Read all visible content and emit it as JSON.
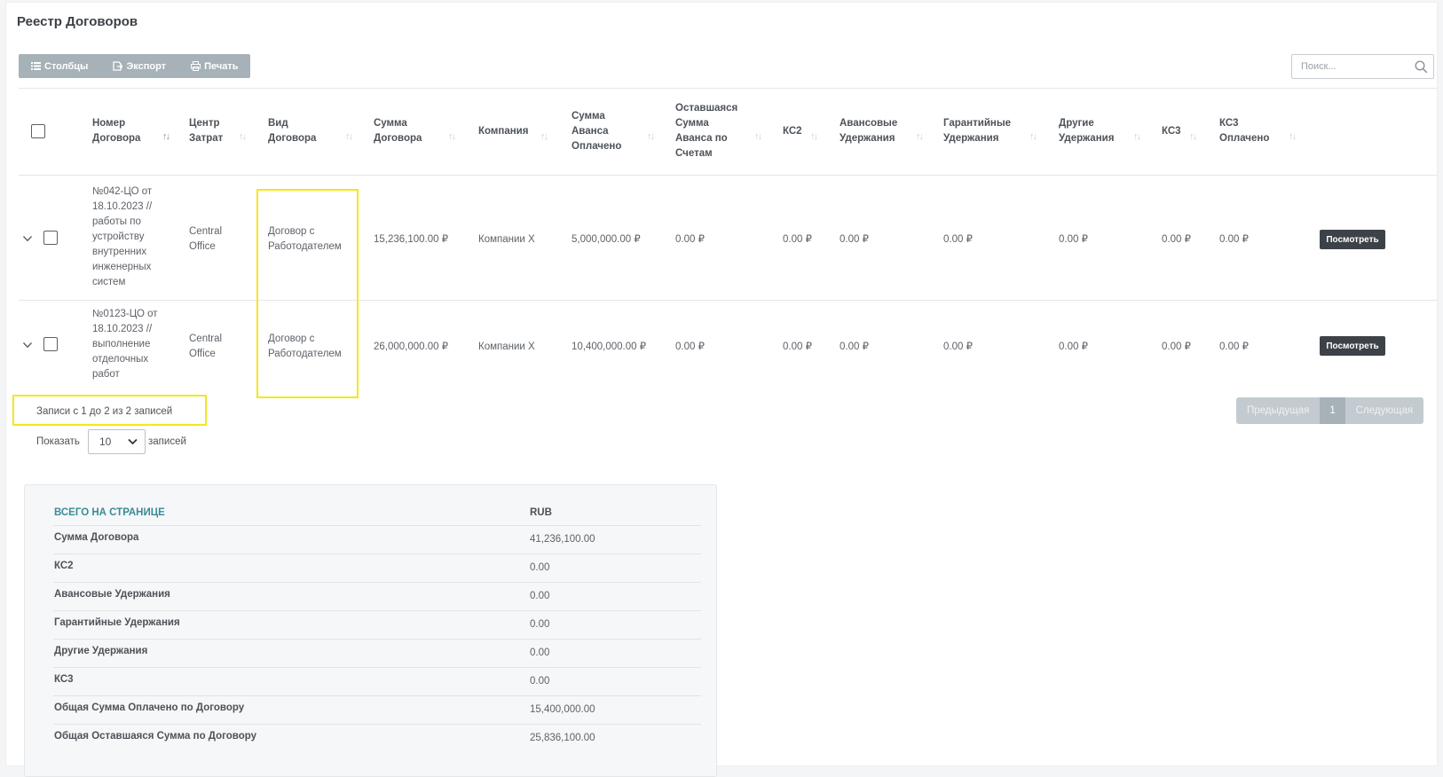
{
  "page": {
    "title": "Реестр Договоров"
  },
  "toolbar": {
    "columns_label": "Столбцы",
    "export_label": "Экспорт",
    "print_label": "Печать"
  },
  "search": {
    "placeholder": "Поиск..."
  },
  "table": {
    "headers": {
      "number": [
        "Номер",
        "Договора"
      ],
      "cost_center": [
        "Центр",
        "Затрат"
      ],
      "type": [
        "Вид",
        "Договора"
      ],
      "amount": [
        "Сумма",
        "Договора"
      ],
      "company": [
        "Компания"
      ],
      "advance_paid": [
        "Сумма",
        "Аванса",
        "Оплачено"
      ],
      "advance_remaining": [
        "Оставшаяся",
        "Сумма",
        "Аванса по",
        "Счетам"
      ],
      "ks2": [
        "КС2"
      ],
      "advance_hold": [
        "Авансовые",
        "Удержания"
      ],
      "warranty_hold": [
        "Гарантийные",
        "Удержания"
      ],
      "other_hold": [
        "Другие",
        "Удержания"
      ],
      "ks3": [
        "КС3"
      ],
      "ks3_paid": [
        "КС3",
        "Оплачено"
      ]
    },
    "rows": [
      {
        "number": [
          "№042-ЦО от",
          "18.10.2023 //",
          "работы по",
          "устройству",
          "внутренних",
          "инженерных",
          "систем"
        ],
        "cost_center": [
          "Central",
          "Office"
        ],
        "type": [
          "Договор с",
          "Работодателем"
        ],
        "amount": "15,236,100.00 ₽",
        "company": "Компании Х",
        "advance_paid": "5,000,000.00 ₽",
        "advance_remaining": "0.00 ₽",
        "ks2": "0.00 ₽",
        "advance_hold": "0.00 ₽",
        "warranty_hold": "0.00 ₽",
        "other_hold": "0.00 ₽",
        "ks3": "0.00 ₽",
        "ks3_paid": "0.00 ₽",
        "view_label": "Посмотреть"
      },
      {
        "number": [
          "№0123-ЦО от",
          "18.10.2023 //",
          "выполнение",
          "отделочных",
          "работ"
        ],
        "cost_center": [
          "Central",
          "Office"
        ],
        "type": [
          "Договор с",
          "Работодателем"
        ],
        "amount": "26,000,000.00 ₽",
        "company": "Компании Х",
        "advance_paid": "10,400,000.00 ₽",
        "advance_remaining": "0.00 ₽",
        "ks2": "0.00 ₽",
        "advance_hold": "0.00 ₽",
        "warranty_hold": "0.00 ₽",
        "other_hold": "0.00 ₽",
        "ks3": "0.00 ₽",
        "ks3_paid": "0.00 ₽",
        "view_label": "Посмотреть"
      }
    ]
  },
  "info": {
    "text": "Записи с 1 до 2 из 2 записей"
  },
  "pagination": {
    "prev": "Предыдущая",
    "current": "1",
    "next": "Следующая"
  },
  "length": {
    "show_label": "Показать",
    "value": "10",
    "suffix": "записей"
  },
  "totals": {
    "heading": "ВСЕГО НА СТРАНИЦЕ",
    "currency": "RUB",
    "rows": [
      {
        "label": "Сумма Договора",
        "value": "41,236,100.00"
      },
      {
        "label": "КС2",
        "value": "0.00"
      },
      {
        "label": "Авансовые Удержания",
        "value": "0.00"
      },
      {
        "label": "Гарантийные Удержания",
        "value": "0.00"
      },
      {
        "label": "Другие Удержания",
        "value": "0.00"
      },
      {
        "label": "КС3",
        "value": "0.00"
      },
      {
        "label": "Общая Сумма Оплачено по Договору",
        "value": "15,400,000.00"
      },
      {
        "label": "Общая Оставшаяся Сумма по Договору",
        "value": "25,836,100.00"
      }
    ]
  },
  "colors": {
    "toolbar_bg": "#a7b1b8",
    "heading_accent": "#3a8a9a",
    "highlight": "#f3e81c",
    "view_button_bg": "#3d4248"
  }
}
